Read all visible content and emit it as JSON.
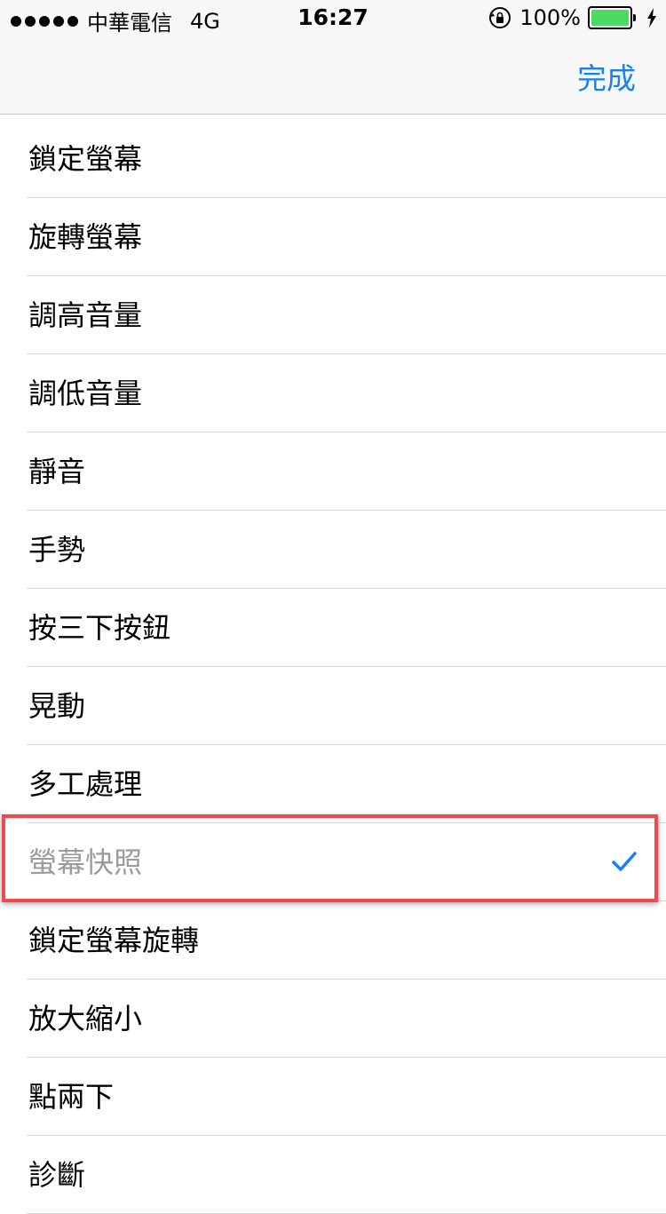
{
  "status_bar": {
    "signal_dots": 5,
    "carrier": "中華電信",
    "network": "4G",
    "time": "16:27",
    "battery_percent": "100%",
    "battery_level": 1.0,
    "icons": [
      "orientation-lock-icon",
      "battery-icon",
      "charging-bolt-icon"
    ]
  },
  "nav": {
    "done_label": "完成"
  },
  "items": [
    {
      "label": "鎖定螢幕"
    },
    {
      "label": "旋轉螢幕"
    },
    {
      "label": "調高音量"
    },
    {
      "label": "調低音量"
    },
    {
      "label": "靜音"
    },
    {
      "label": "手勢"
    },
    {
      "label": "按三下按鈕"
    },
    {
      "label": "晃動"
    },
    {
      "label": "多工處理"
    },
    {
      "label": "螢幕快照",
      "selected": true
    },
    {
      "label": "鎖定螢幕旋轉"
    },
    {
      "label": "放大縮小"
    },
    {
      "label": "點兩下"
    },
    {
      "label": "診斷"
    }
  ],
  "colors": {
    "accent": "#1a7ff5",
    "highlight_border": "#f0484e",
    "battery": "#4cd964"
  }
}
